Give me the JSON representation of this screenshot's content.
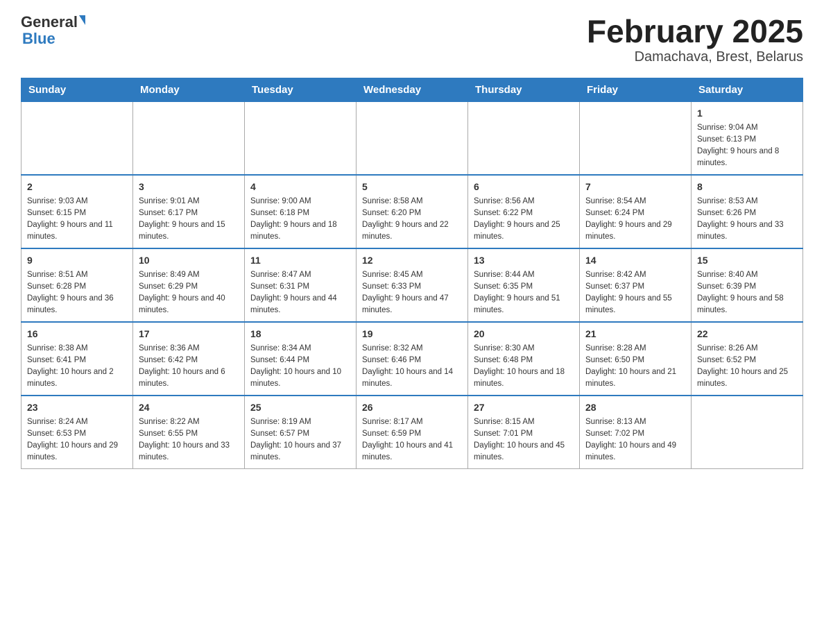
{
  "header": {
    "logo_general": "General",
    "logo_blue": "Blue",
    "title": "February 2025",
    "subtitle": "Damachava, Brest, Belarus"
  },
  "days_of_week": [
    "Sunday",
    "Monday",
    "Tuesday",
    "Wednesday",
    "Thursday",
    "Friday",
    "Saturday"
  ],
  "weeks": [
    [
      {
        "day": "",
        "info": ""
      },
      {
        "day": "",
        "info": ""
      },
      {
        "day": "",
        "info": ""
      },
      {
        "day": "",
        "info": ""
      },
      {
        "day": "",
        "info": ""
      },
      {
        "day": "",
        "info": ""
      },
      {
        "day": "1",
        "info": "Sunrise: 9:04 AM\nSunset: 6:13 PM\nDaylight: 9 hours and 8 minutes."
      }
    ],
    [
      {
        "day": "2",
        "info": "Sunrise: 9:03 AM\nSunset: 6:15 PM\nDaylight: 9 hours and 11 minutes."
      },
      {
        "day": "3",
        "info": "Sunrise: 9:01 AM\nSunset: 6:17 PM\nDaylight: 9 hours and 15 minutes."
      },
      {
        "day": "4",
        "info": "Sunrise: 9:00 AM\nSunset: 6:18 PM\nDaylight: 9 hours and 18 minutes."
      },
      {
        "day": "5",
        "info": "Sunrise: 8:58 AM\nSunset: 6:20 PM\nDaylight: 9 hours and 22 minutes."
      },
      {
        "day": "6",
        "info": "Sunrise: 8:56 AM\nSunset: 6:22 PM\nDaylight: 9 hours and 25 minutes."
      },
      {
        "day": "7",
        "info": "Sunrise: 8:54 AM\nSunset: 6:24 PM\nDaylight: 9 hours and 29 minutes."
      },
      {
        "day": "8",
        "info": "Sunrise: 8:53 AM\nSunset: 6:26 PM\nDaylight: 9 hours and 33 minutes."
      }
    ],
    [
      {
        "day": "9",
        "info": "Sunrise: 8:51 AM\nSunset: 6:28 PM\nDaylight: 9 hours and 36 minutes."
      },
      {
        "day": "10",
        "info": "Sunrise: 8:49 AM\nSunset: 6:29 PM\nDaylight: 9 hours and 40 minutes."
      },
      {
        "day": "11",
        "info": "Sunrise: 8:47 AM\nSunset: 6:31 PM\nDaylight: 9 hours and 44 minutes."
      },
      {
        "day": "12",
        "info": "Sunrise: 8:45 AM\nSunset: 6:33 PM\nDaylight: 9 hours and 47 minutes."
      },
      {
        "day": "13",
        "info": "Sunrise: 8:44 AM\nSunset: 6:35 PM\nDaylight: 9 hours and 51 minutes."
      },
      {
        "day": "14",
        "info": "Sunrise: 8:42 AM\nSunset: 6:37 PM\nDaylight: 9 hours and 55 minutes."
      },
      {
        "day": "15",
        "info": "Sunrise: 8:40 AM\nSunset: 6:39 PM\nDaylight: 9 hours and 58 minutes."
      }
    ],
    [
      {
        "day": "16",
        "info": "Sunrise: 8:38 AM\nSunset: 6:41 PM\nDaylight: 10 hours and 2 minutes."
      },
      {
        "day": "17",
        "info": "Sunrise: 8:36 AM\nSunset: 6:42 PM\nDaylight: 10 hours and 6 minutes."
      },
      {
        "day": "18",
        "info": "Sunrise: 8:34 AM\nSunset: 6:44 PM\nDaylight: 10 hours and 10 minutes."
      },
      {
        "day": "19",
        "info": "Sunrise: 8:32 AM\nSunset: 6:46 PM\nDaylight: 10 hours and 14 minutes."
      },
      {
        "day": "20",
        "info": "Sunrise: 8:30 AM\nSunset: 6:48 PM\nDaylight: 10 hours and 18 minutes."
      },
      {
        "day": "21",
        "info": "Sunrise: 8:28 AM\nSunset: 6:50 PM\nDaylight: 10 hours and 21 minutes."
      },
      {
        "day": "22",
        "info": "Sunrise: 8:26 AM\nSunset: 6:52 PM\nDaylight: 10 hours and 25 minutes."
      }
    ],
    [
      {
        "day": "23",
        "info": "Sunrise: 8:24 AM\nSunset: 6:53 PM\nDaylight: 10 hours and 29 minutes."
      },
      {
        "day": "24",
        "info": "Sunrise: 8:22 AM\nSunset: 6:55 PM\nDaylight: 10 hours and 33 minutes."
      },
      {
        "day": "25",
        "info": "Sunrise: 8:19 AM\nSunset: 6:57 PM\nDaylight: 10 hours and 37 minutes."
      },
      {
        "day": "26",
        "info": "Sunrise: 8:17 AM\nSunset: 6:59 PM\nDaylight: 10 hours and 41 minutes."
      },
      {
        "day": "27",
        "info": "Sunrise: 8:15 AM\nSunset: 7:01 PM\nDaylight: 10 hours and 45 minutes."
      },
      {
        "day": "28",
        "info": "Sunrise: 8:13 AM\nSunset: 7:02 PM\nDaylight: 10 hours and 49 minutes."
      },
      {
        "day": "",
        "info": ""
      }
    ]
  ]
}
